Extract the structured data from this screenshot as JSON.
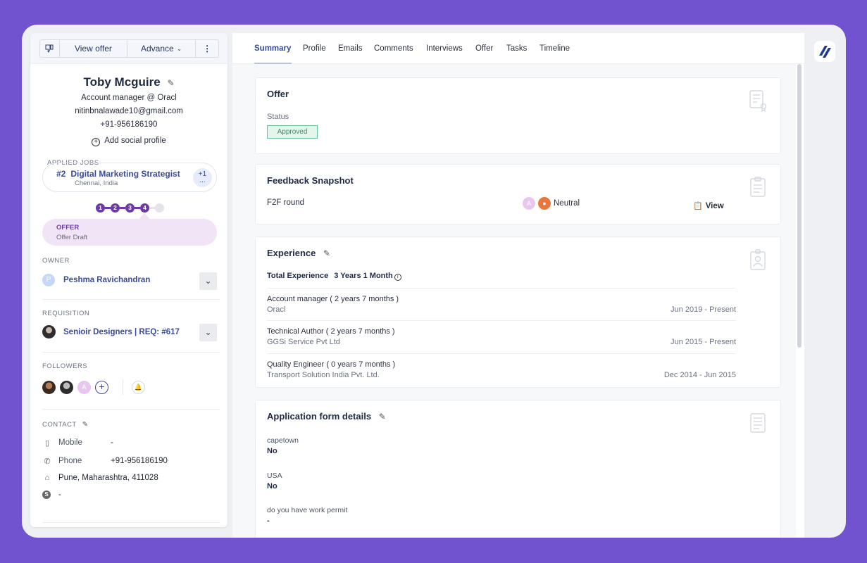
{
  "colors": {
    "background": "#7152cf",
    "accent": "#3a4a9a",
    "stage": "#6b3aa7",
    "approved_border": "#67c39a"
  },
  "toolbar": {
    "dislike_icon": "thumbs-down-icon",
    "view_offer": "View offer",
    "advance": "Advance",
    "more": "⋮"
  },
  "candidate": {
    "name": "Toby Mcguire",
    "title": "Account manager @ Oracl",
    "email": "nitinbnalawade10@gmail.com",
    "phone": "+91-956186190",
    "add_social": "Add social profile"
  },
  "applied_jobs": {
    "label": "APPLIED JOBS",
    "job_number": "#2",
    "job_title": "Digital Marketing Strategist",
    "job_location": "Chennai, India",
    "more_count": "+1",
    "more_dots": "...",
    "steps": [
      "1",
      "2",
      "3",
      "4"
    ],
    "stage_title": "OFFER",
    "stage_sub": "Offer Draft"
  },
  "owner": {
    "label": "OWNER",
    "initial": "P",
    "name": "Peshma Ravichandran"
  },
  "requisition": {
    "label": "REQUISITION",
    "name": "Senioir Designers | REQ: #617"
  },
  "followers": {
    "label": "FOLLOWERS",
    "initial": "A"
  },
  "contact": {
    "label": "CONTACT",
    "mobile_label": "Mobile",
    "mobile_value": "-",
    "phone_label": "Phone",
    "phone_value": "+91-956186190",
    "address": "Pune, Maharashtra, 411028",
    "skype": "-"
  },
  "tabs": [
    "Summary",
    "Profile",
    "Emails",
    "Comments",
    "Interviews",
    "Offer",
    "Tasks",
    "Timeline"
  ],
  "offer": {
    "title": "Offer",
    "status_label": "Status",
    "status_value": "Approved"
  },
  "feedback": {
    "title": "Feedback Snapshot",
    "round": "F2F round",
    "avatar_initial": "A",
    "rating": "Neutral",
    "view": "View"
  },
  "experience": {
    "title": "Experience",
    "total_label": "Total Experience",
    "total_value": "3 Years 1 Month",
    "items": [
      {
        "role": "Account manager ( 2 years 7 months )",
        "company": "Oracl",
        "dates": "Jun 2019 - Present"
      },
      {
        "role": "Technical Author ( 2 years 7 months )",
        "company": "GGSi Service Pvt Ltd",
        "dates": "Jun 2015 - Present"
      },
      {
        "role": "Quality Engineer ( 0 years 7 months )",
        "company": "Transport Solution India Pvt. Ltd.",
        "dates": "Dec 2014 - Jun 2015"
      }
    ]
  },
  "application_form": {
    "title": "Application form details",
    "fields": [
      {
        "question": "capetown",
        "answer": "No"
      },
      {
        "question": "USA",
        "answer": "No"
      },
      {
        "question": "do you have work permit",
        "answer": "-"
      }
    ]
  }
}
